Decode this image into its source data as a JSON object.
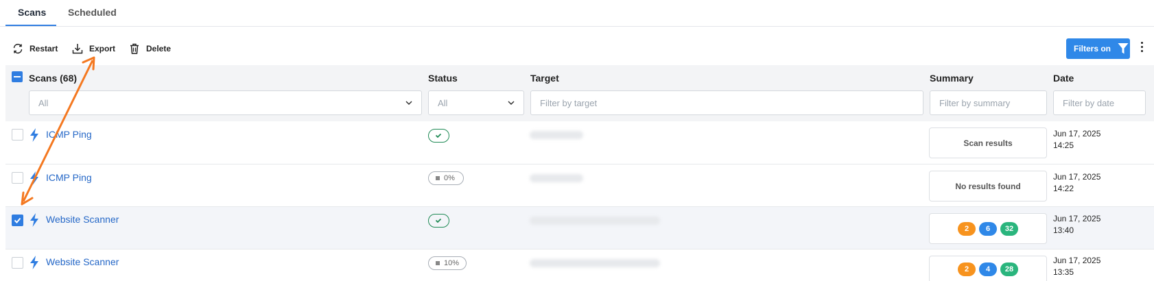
{
  "tabs": {
    "scans": "Scans",
    "scheduled": "Scheduled"
  },
  "toolbar": {
    "restart": "Restart",
    "export": "Export",
    "delete": "Delete",
    "filters_on": "Filters on"
  },
  "table": {
    "headers": {
      "scans": "Scans (68)",
      "status": "Status",
      "target": "Target",
      "summary": "Summary",
      "date": "Date"
    },
    "filters": {
      "scans_value": "All",
      "status_value": "All",
      "target_placeholder": "Filter by target",
      "summary_placeholder": "Filter by summary",
      "date_placeholder": "Filter by date"
    },
    "rows": [
      {
        "name": "ICMP Ping",
        "status": "done",
        "summary_text": "Scan results",
        "date": "Jun 17, 2025",
        "time": "14:25",
        "selected": false
      },
      {
        "name": "ICMP Ping",
        "status": "0%",
        "summary_text": "No results found",
        "date": "Jun 17, 2025",
        "time": "14:22",
        "selected": false
      },
      {
        "name": "Website Scanner",
        "status": "done",
        "counts": [
          "2",
          "6",
          "32"
        ],
        "date": "Jun 17, 2025",
        "time": "13:40",
        "selected": true
      },
      {
        "name": "Website Scanner",
        "status": "10%",
        "counts": [
          "2",
          "4",
          "28"
        ],
        "date": "Jun 17, 2025",
        "time": "13:35",
        "selected": false
      }
    ]
  },
  "colors": {
    "accent": "#2f7de1",
    "link": "#2467c7",
    "annotation": "#f47820",
    "success": "#1f8a55"
  },
  "icons": [
    "restart-icon",
    "download-icon",
    "trash-icon",
    "filter-icon",
    "kebab-icon",
    "chevron-down-icon",
    "bolt-icon",
    "check-icon"
  ]
}
